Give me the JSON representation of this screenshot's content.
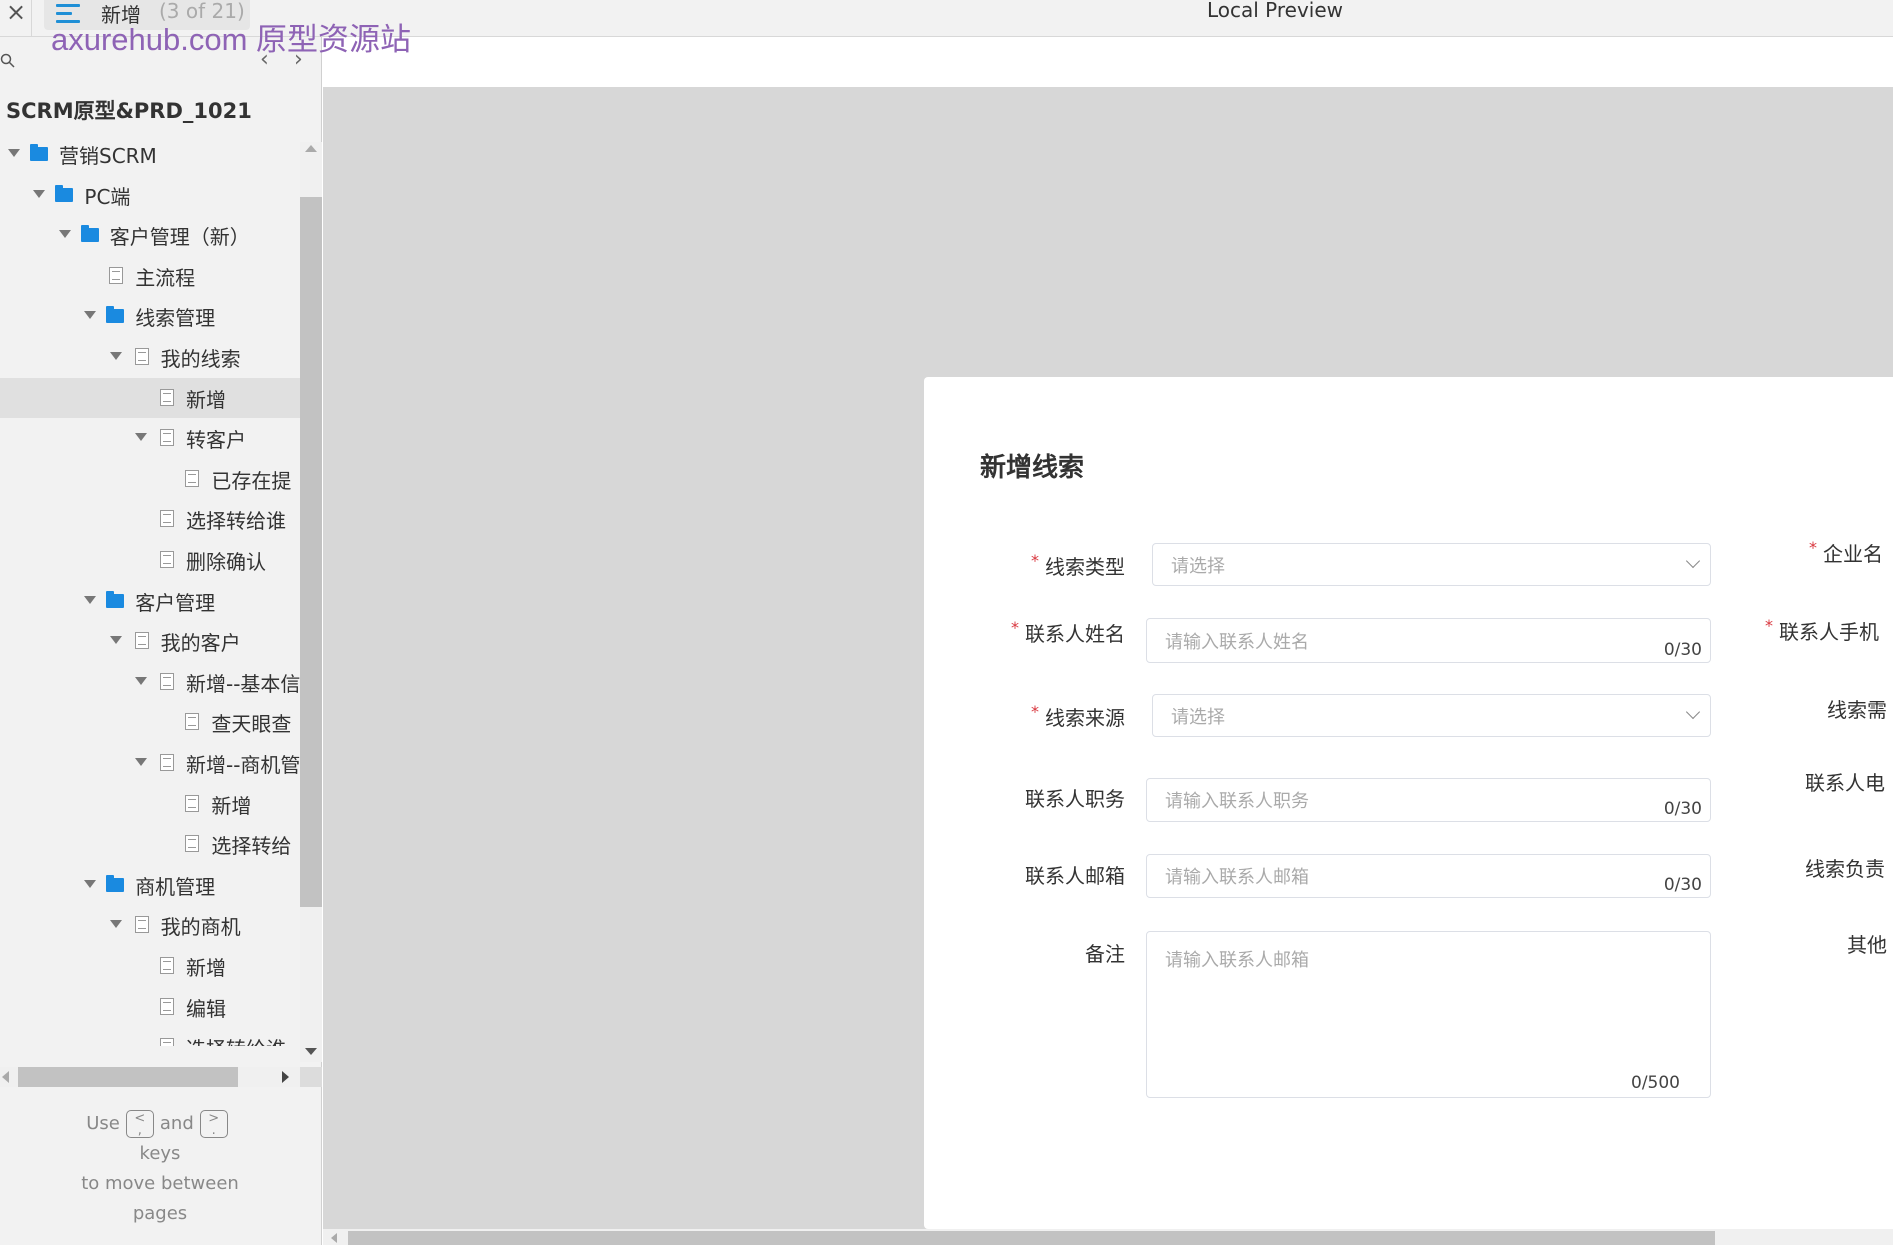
{
  "topbar": {
    "close_icon": "close-icon",
    "menu_icon": "hamburger-icon",
    "page_name": "新增",
    "page_count": "(3 of 21)",
    "preview_title": "Local Preview",
    "watermark": "axurehub.com 原型资源站"
  },
  "sidebar": {
    "prev_icon": "‹",
    "next_icon": "›",
    "project_title": "SCRM原型&PRD_1021",
    "tree": [
      {
        "label": "营销SCRM",
        "level": 0,
        "type": "folder",
        "expanded": true
      },
      {
        "label": "PC端",
        "level": 1,
        "type": "folder",
        "expanded": true
      },
      {
        "label": "客户管理（新）",
        "level": 2,
        "type": "folder",
        "expanded": true
      },
      {
        "label": "主流程",
        "level": 3,
        "type": "page",
        "expanded": false
      },
      {
        "label": "线索管理",
        "level": 3,
        "type": "folder",
        "expanded": true
      },
      {
        "label": "我的线索",
        "level": 4,
        "type": "page",
        "expanded": true
      },
      {
        "label": "新增",
        "level": 5,
        "type": "page",
        "expanded": false,
        "selected": true
      },
      {
        "label": "转客户",
        "level": 5,
        "type": "page",
        "expanded": true
      },
      {
        "label": "已存在提",
        "level": 6,
        "type": "page",
        "expanded": false
      },
      {
        "label": "选择转给谁",
        "level": 5,
        "type": "page",
        "expanded": false
      },
      {
        "label": "删除确认",
        "level": 5,
        "type": "page",
        "expanded": false
      },
      {
        "label": "客户管理",
        "level": 3,
        "type": "folder",
        "expanded": true
      },
      {
        "label": "我的客户",
        "level": 4,
        "type": "page",
        "expanded": true
      },
      {
        "label": "新增--基本信",
        "level": 5,
        "type": "page",
        "expanded": true
      },
      {
        "label": "查天眼查",
        "level": 6,
        "type": "page",
        "expanded": false
      },
      {
        "label": "新增--商机管",
        "level": 5,
        "type": "page",
        "expanded": true
      },
      {
        "label": "新增",
        "level": 6,
        "type": "page",
        "expanded": false
      },
      {
        "label": "选择转给",
        "level": 6,
        "type": "page",
        "expanded": false
      },
      {
        "label": "商机管理",
        "level": 3,
        "type": "folder",
        "expanded": true
      },
      {
        "label": "我的商机",
        "level": 4,
        "type": "page",
        "expanded": true
      },
      {
        "label": "新增",
        "level": 5,
        "type": "page",
        "expanded": false
      },
      {
        "label": "编辑",
        "level": 5,
        "type": "page",
        "expanded": false
      },
      {
        "label": "选择转给谁",
        "level": 5,
        "type": "page",
        "expanded": false
      }
    ],
    "help": {
      "use": "Use",
      "key_prev": "<\n,",
      "and": "and",
      "key_next": ">\n.",
      "keys": "keys",
      "move": "to move between",
      "pages": "pages"
    }
  },
  "form": {
    "title": "新增线索",
    "left_fields": [
      {
        "label": "线索类型",
        "required": true,
        "kind": "select",
        "placeholder": "请选择"
      },
      {
        "label": "联系人姓名",
        "required": true,
        "kind": "input",
        "placeholder": "请输入联系人姓名",
        "count": "0/30"
      },
      {
        "label": "线索来源",
        "required": true,
        "kind": "select",
        "placeholder": "请选择"
      },
      {
        "label": "联系人职务",
        "required": false,
        "kind": "input",
        "placeholder": "请输入联系人职务",
        "count": "0/30"
      },
      {
        "label": "联系人邮箱",
        "required": false,
        "kind": "input",
        "placeholder": "请输入联系人邮箱",
        "count": "0/30"
      },
      {
        "label": "备注",
        "required": false,
        "kind": "textarea",
        "placeholder": "请输入联系人邮箱",
        "count": "0/500"
      }
    ],
    "right_labels": [
      {
        "label": "企业名",
        "required": true
      },
      {
        "label": "联系人手机",
        "required": true
      },
      {
        "label": "线索需",
        "required": false
      },
      {
        "label": "联系人电",
        "required": false
      },
      {
        "label": "线索负责",
        "required": false
      },
      {
        "label": "其他",
        "required": false
      }
    ],
    "required_color": "#d9363e"
  },
  "colors": {
    "accent": "#1a8ae0",
    "watermark": "#8e63b5",
    "canvas": "#d7d7d7"
  }
}
